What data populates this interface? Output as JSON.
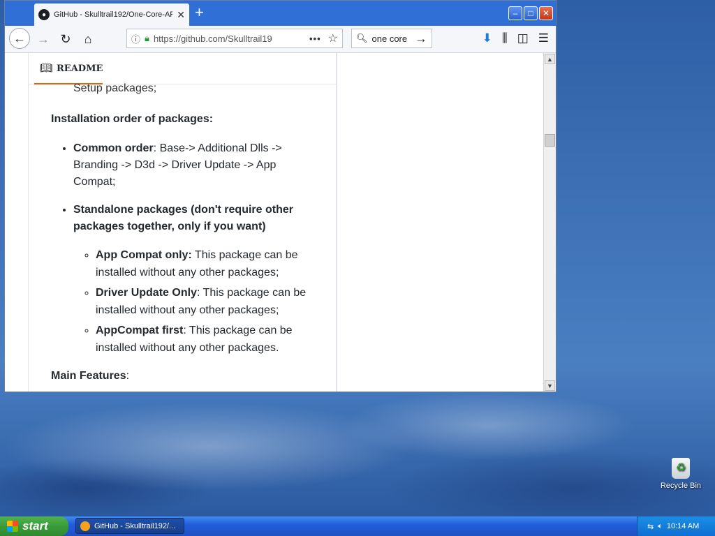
{
  "browser": {
    "tab_title": "GitHub - Skulltrail192/One-Core-AP",
    "tab_close": "✕",
    "new_tab": "+",
    "url": "https://github.com/Skulltrail19",
    "url_more": "•••",
    "search_text": "one core",
    "window_buttons": {
      "minimize": "–",
      "maximize": "□",
      "close": "✕"
    }
  },
  "readme": {
    "heading": "README",
    "setup_tail": "Setup packages;",
    "install_order_title": "Installation order of packages:",
    "common_order_label": "Common order",
    "common_order_text": ": Base-> Additional Dlls -> Branding -> D3d -> Driver Update -> App Compat;",
    "standalone_label": "Standalone packages (don't require other packages together, only if you want)",
    "sub_items": [
      {
        "label": "App Compat only:",
        "text": " This package can be installed without any other packages;"
      },
      {
        "label": "Driver Update Only",
        "text": ": This package can be installed without any other packages;"
      },
      {
        "label": "AppCompat first",
        "text": ": This package can be installed without any other packages."
      }
    ],
    "main_features_label": "Main Features",
    "main_features_colon": ":"
  },
  "desktop": {
    "recycle_bin_label": "Recycle Bin"
  },
  "taskbar": {
    "start_label": "start",
    "task_label": "GitHub - Skulltrail192/...",
    "clock": "10:14 AM"
  },
  "colors": {
    "tabbar": "#2f6fd6",
    "readme_accent": "#e36209",
    "start_green": "#3a9b3a",
    "taskbar_blue": "#245edb"
  }
}
